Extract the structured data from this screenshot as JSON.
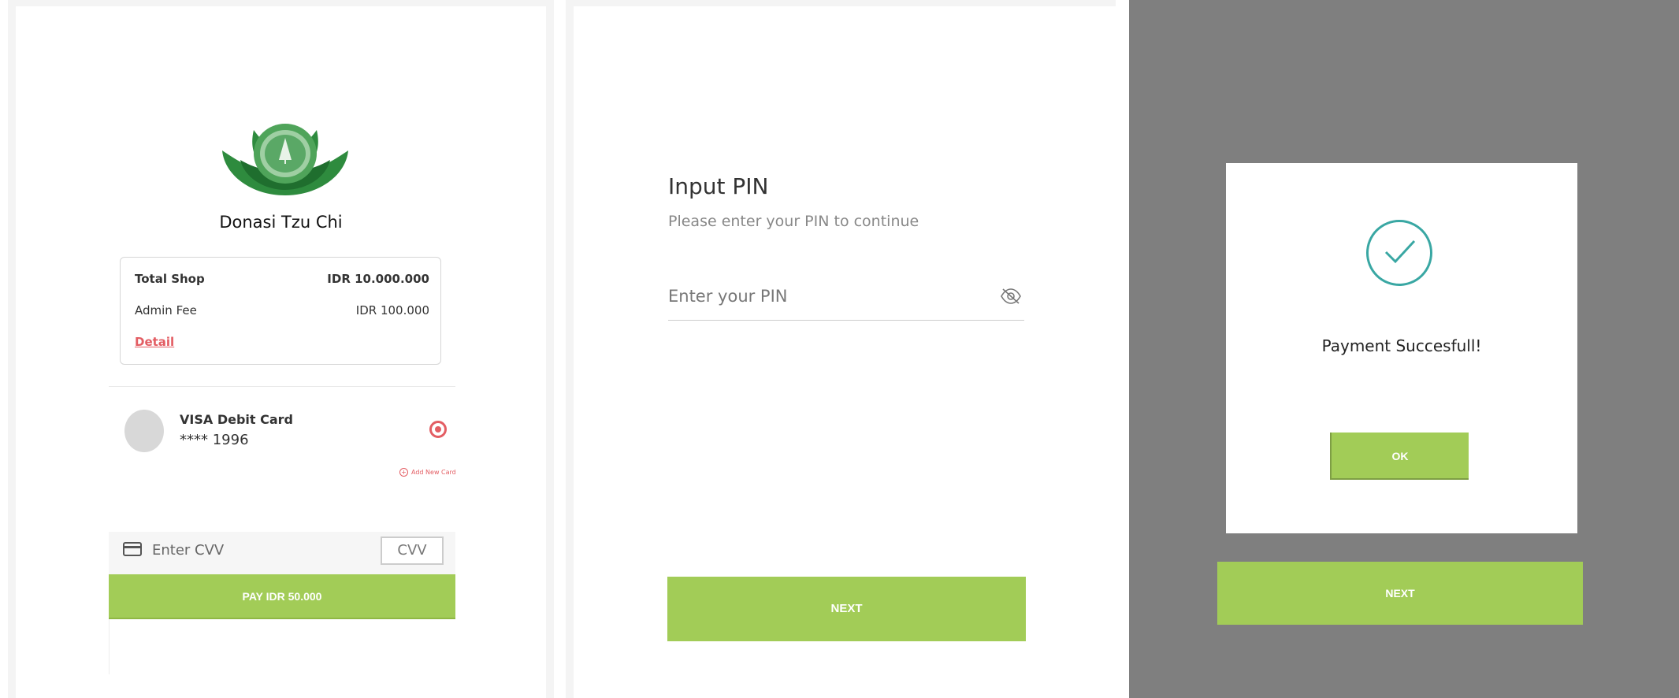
{
  "screen1": {
    "brand": "Donasi Tzu Chi",
    "summary": {
      "total_label": "Total Shop",
      "total_value": "IDR 10.000.000",
      "admin_label": "Admin Fee",
      "admin_value": "IDR 100.000",
      "detail_link": "Detail"
    },
    "card": {
      "name": "VISA Debit Card",
      "number": "**** 1996",
      "selected": true
    },
    "add_card": "Add New Card",
    "cvv": {
      "label": "Enter CVV",
      "placeholder": "CVV"
    },
    "pay_button": "PAY IDR 50.000",
    "colors": {
      "accent": "#a2cc57",
      "link": "#e35d63"
    }
  },
  "screen2": {
    "title": "Input PIN",
    "subtitle": "Please enter your PIN to continue",
    "pin_placeholder": "Enter your PIN",
    "next_button": "NEXT"
  },
  "screen3": {
    "message": "Payment Succesfull!",
    "ok_button": "OK",
    "next_button": "NEXT",
    "colors": {
      "overlay": "#7f7f7f",
      "success": "#39a7a3"
    }
  }
}
